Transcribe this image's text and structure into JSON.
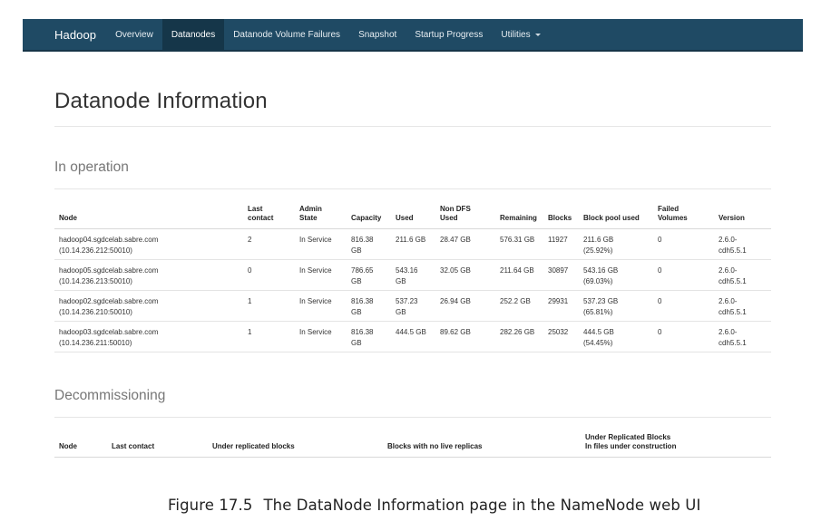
{
  "navbar": {
    "brand": "Hadoop",
    "items": [
      {
        "label": "Overview"
      },
      {
        "label": "Datanodes"
      },
      {
        "label": "Datanode Volume Failures"
      },
      {
        "label": "Snapshot"
      },
      {
        "label": "Startup Progress"
      },
      {
        "label": "Utilities"
      }
    ]
  },
  "page_title": "Datanode Information",
  "in_operation": {
    "title": "In operation",
    "headers": {
      "node": "Node",
      "last_contact_1": "Last",
      "last_contact_2": "contact",
      "admin_state_1": "Admin",
      "admin_state_2": "State",
      "capacity": "Capacity",
      "used": "Used",
      "non_dfs_1": "Non DFS",
      "non_dfs_2": "Used",
      "remaining": "Remaining",
      "blocks": "Blocks",
      "block_pool_used": "Block pool used",
      "failed_volumes_1": "Failed",
      "failed_volumes_2": "Volumes",
      "version": "Version"
    },
    "rows": [
      {
        "node_host": "hadoop04.sgdcelab.sabre.com",
        "node_addr": "(10.14.236.212:50010)",
        "last_contact": "2",
        "admin_state": "In Service",
        "capacity_1": "816.38",
        "capacity_2": "GB",
        "used_1": "211.6 GB",
        "used_2": "",
        "non_dfs": "28.47 GB",
        "remaining": "576.31 GB",
        "blocks": "11927",
        "bp_used_1": "211.6 GB",
        "bp_used_2": "(25.92%)",
        "failed_volumes": "0",
        "version_1": "2.6.0-",
        "version_2": "cdh5.5.1"
      },
      {
        "node_host": "hadoop05.sgdcelab.sabre.com",
        "node_addr": "(10.14.236.213:50010)",
        "last_contact": "0",
        "admin_state": "In Service",
        "capacity_1": "786.65",
        "capacity_2": "GB",
        "used_1": "543.16",
        "used_2": "GB",
        "non_dfs": "32.05 GB",
        "remaining": "211.64 GB",
        "blocks": "30897",
        "bp_used_1": "543.16 GB",
        "bp_used_2": "(69.03%)",
        "failed_volumes": "0",
        "version_1": "2.6.0-",
        "version_2": "cdh5.5.1"
      },
      {
        "node_host": "hadoop02.sgdcelab.sabre.com",
        "node_addr": "(10.14.236.210:50010)",
        "last_contact": "1",
        "admin_state": "In Service",
        "capacity_1": "816.38",
        "capacity_2": "GB",
        "used_1": "537.23",
        "used_2": "GB",
        "non_dfs": "26.94 GB",
        "remaining": "252.2 GB",
        "blocks": "29931",
        "bp_used_1": "537.23 GB",
        "bp_used_2": "(65.81%)",
        "failed_volumes": "0",
        "version_1": "2.6.0-",
        "version_2": "cdh5.5.1"
      },
      {
        "node_host": "hadoop03.sgdcelab.sabre.com",
        "node_addr": "(10.14.236.211:50010)",
        "last_contact": "1",
        "admin_state": "In Service",
        "capacity_1": "816.38",
        "capacity_2": "GB",
        "used_1": "444.5 GB",
        "used_2": "",
        "non_dfs": "89.62 GB",
        "remaining": "282.26 GB",
        "blocks": "25032",
        "bp_used_1": "444.5 GB",
        "bp_used_2": "(54.45%)",
        "failed_volumes": "0",
        "version_1": "2.6.0-",
        "version_2": "cdh5.5.1"
      }
    ]
  },
  "decommissioning": {
    "title": "Decommissioning",
    "headers": {
      "node": "Node",
      "last_contact": "Last contact",
      "under_replicated": "Under replicated blocks",
      "no_live_replicas": "Blocks with no live replicas",
      "under_constr_1": "Under Replicated Blocks",
      "under_constr_2": "In files under construction"
    }
  },
  "caption": {
    "figure_number": "Figure 17.5",
    "text": "The DataNode Information page in the NameNode web UI"
  }
}
